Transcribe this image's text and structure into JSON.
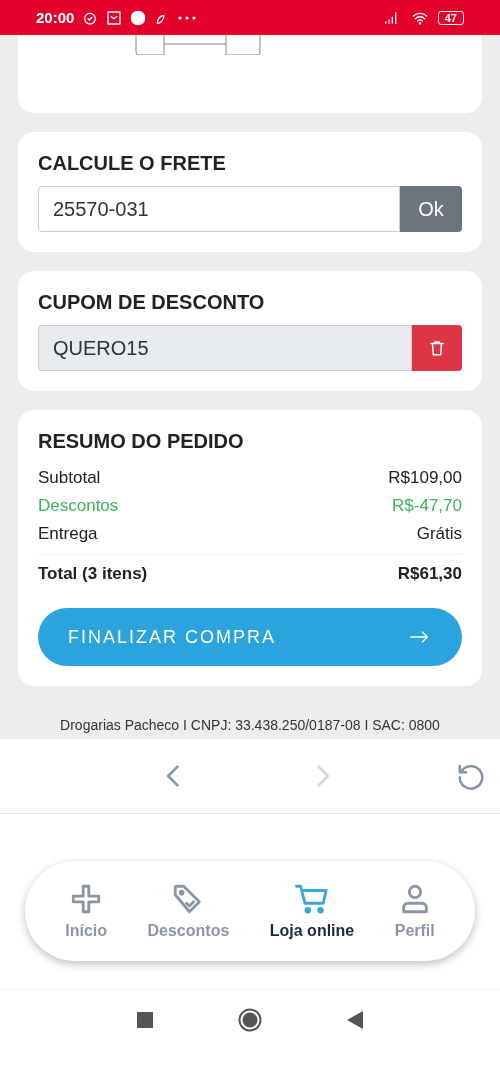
{
  "status_bar": {
    "time": "20:00",
    "battery": "47"
  },
  "shipping": {
    "title": "CALCULE O FRETE",
    "value": "25570-031",
    "button": "Ok"
  },
  "coupon": {
    "title": "CUPOM DE DESCONTO",
    "value": "QUERO15"
  },
  "summary": {
    "title": "RESUMO DO PEDIDO",
    "rows": [
      {
        "label": "Subtotal",
        "value": "R$109,00",
        "kind": "normal"
      },
      {
        "label": "Descontos",
        "value": "R$-47,70",
        "kind": "discount"
      },
      {
        "label": "Entrega",
        "value": "Grátis",
        "kind": "normal"
      }
    ],
    "total": {
      "label": "Total (3 itens)",
      "value": "R$61,30"
    },
    "button": "FINALIZAR COMPRA"
  },
  "footer": "Drogarias Pacheco I CNPJ: 33.438.250/0187-08 I SAC: 0800",
  "browser_nav": {
    "back": {
      "disabled": false
    },
    "forward": {
      "disabled": true
    }
  },
  "tabs": [
    {
      "label": "Início",
      "kind": "home",
      "selected": false
    },
    {
      "label": "Descontos",
      "kind": "tag",
      "selected": false
    },
    {
      "label": "Loja online",
      "kind": "cart",
      "selected": true
    },
    {
      "label": "Perfil",
      "kind": "user",
      "selected": false
    }
  ]
}
